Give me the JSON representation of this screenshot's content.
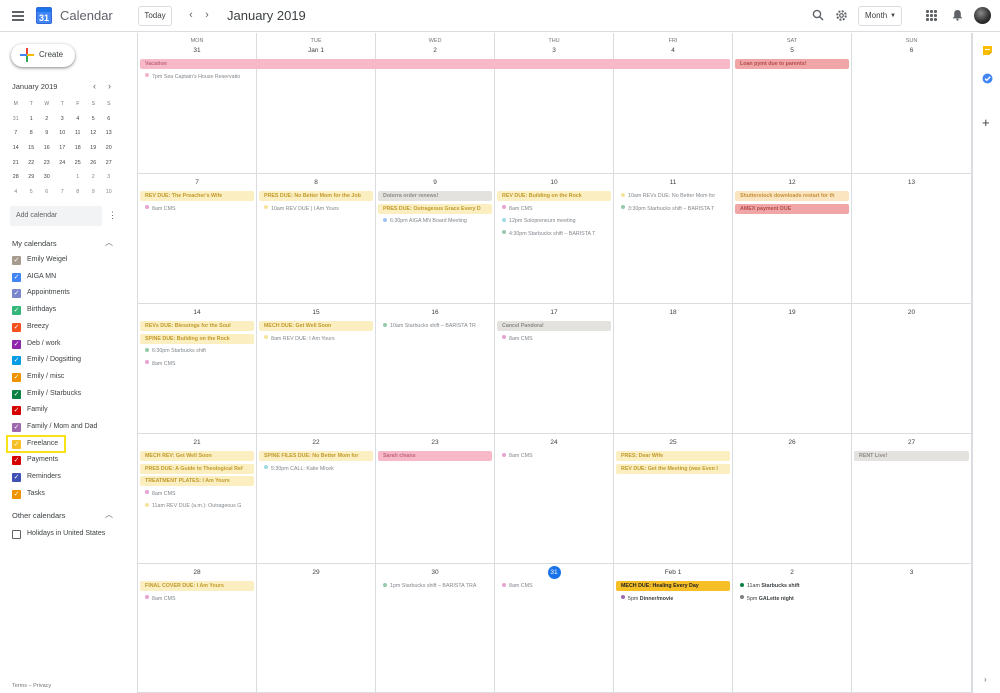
{
  "header": {
    "app_title": "Calendar",
    "logo_day": "31",
    "today_label": "Today",
    "prev_label": "‹",
    "next_label": "›",
    "month_title": "January 2019",
    "view_label": "Month",
    "icons": [
      "menu-icon",
      "search-icon",
      "gear-icon",
      "apps-icon",
      "notifications-icon"
    ]
  },
  "sidebar": {
    "create_label": "Create",
    "mini_calendar": {
      "title": "January 2019",
      "weekdays": [
        "M",
        "T",
        "W",
        "T",
        "F",
        "S",
        "S"
      ],
      "weeks": [
        [
          "31",
          "1",
          "2",
          "3",
          "4",
          "5",
          "6"
        ],
        [
          "7",
          "8",
          "9",
          "10",
          "11",
          "12",
          "13"
        ],
        [
          "14",
          "15",
          "16",
          "17",
          "18",
          "19",
          "20"
        ],
        [
          "21",
          "22",
          "23",
          "24",
          "25",
          "26",
          "27"
        ],
        [
          "28",
          "29",
          "30",
          "31",
          "1",
          "2",
          "3"
        ],
        [
          "4",
          "5",
          "6",
          "7",
          "8",
          "9",
          "10"
        ]
      ],
      "selected_day": "1",
      "today_day": "31"
    },
    "add_calendar_placeholder": "Add calendar",
    "my_calendars_title": "My calendars",
    "my_calendars": [
      {
        "name": "Emily Weigel",
        "color": "#a79b8e"
      },
      {
        "name": "AIGA MN",
        "color": "#4285f4"
      },
      {
        "name": "Appointments",
        "color": "#7986cb"
      },
      {
        "name": "Birthdays",
        "color": "#33b679"
      },
      {
        "name": "Breezy",
        "color": "#f4511e"
      },
      {
        "name": "Deb / work",
        "color": "#8e24aa"
      },
      {
        "name": "Emily / Dogsitting",
        "color": "#039be5"
      },
      {
        "name": "Emily / misc",
        "color": "#f09300"
      },
      {
        "name": "Emily / Starbucks",
        "color": "#0b8043"
      },
      {
        "name": "Family",
        "color": "#d50000"
      },
      {
        "name": "Family / Mom and Dad",
        "color": "#9e69af"
      },
      {
        "name": "Freelance",
        "color": "#f6bf26"
      },
      {
        "name": "Payments",
        "color": "#d50000"
      },
      {
        "name": "Reminders",
        "color": "#3f51b5"
      },
      {
        "name": "Tasks",
        "color": "#f09300"
      }
    ],
    "highlighted_calendar": "Freelance",
    "other_calendars_title": "Other calendars",
    "other_calendars": [
      {
        "name": "Holidays in United States",
        "checked": false
      }
    ],
    "footer": {
      "terms": "Terms",
      "separator": "–",
      "privacy": "Privacy"
    }
  },
  "grid": {
    "weekday_labels": [
      "MON",
      "TUE",
      "WED",
      "THU",
      "FRI",
      "SAT",
      "SUN"
    ],
    "weeks": [
      {
        "days": [
          "31",
          "Jan 1",
          "2",
          "3",
          "4",
          "5",
          "6"
        ],
        "events": [
          {
            "col": 0,
            "span": 5,
            "row": 0,
            "text": "Vacation",
            "kind": "bar",
            "bg": "#f7b8c8",
            "fg": "#c1667d"
          },
          {
            "col": 5,
            "span": 1,
            "row": 0,
            "text": "Loan pymt due to parents!",
            "kind": "bar",
            "bg": "#f0a6a6",
            "fg": "#b34c4c"
          },
          {
            "col": 0,
            "span": 1,
            "row": 1,
            "time": "7pm",
            "text": "Sea Captain's House Reservatio",
            "kind": "timed",
            "dot": "#f2b6c6",
            "dim": true
          }
        ]
      },
      {
        "days": [
          "7",
          "8",
          "9",
          "10",
          "11",
          "12",
          "13"
        ],
        "events": [
          {
            "col": 0,
            "span": 1,
            "row": 0,
            "text": "REV DUE: The Preacher's Wife",
            "kind": "bar",
            "bg": "#fbeec0",
            "fg": "#c19a2a"
          },
          {
            "col": 0,
            "span": 1,
            "row": 1,
            "time": "8am",
            "text": "CMS",
            "kind": "timed",
            "dot": "#e6a2d3",
            "dim": true
          },
          {
            "col": 1,
            "span": 1,
            "row": 0,
            "text": "PRES DUE: No Better Mom for the Job",
            "kind": "bar",
            "bg": "#fbeec0",
            "fg": "#c19a2a"
          },
          {
            "col": 1,
            "span": 1,
            "row": 1,
            "time": "10am",
            "text": "REV DUE | I Am Yours",
            "kind": "timed",
            "dot": "#f6e49a",
            "dim": true
          },
          {
            "col": 2,
            "span": 1,
            "row": 0,
            "text": "Doterra order renews!",
            "kind": "bar",
            "bg": "#e4e2de",
            "fg": "#8d8a85"
          },
          {
            "col": 2,
            "span": 1,
            "row": 1,
            "text": "PRES DUE: Outrageous Grace Every D",
            "kind": "bar",
            "bg": "#fbeec0",
            "fg": "#c19a2a"
          },
          {
            "col": 2,
            "span": 1,
            "row": 2,
            "time": "6:30pm",
            "text": "AIGA MN Board Meeting",
            "kind": "timed",
            "dot": "#9ec2f6",
            "dim": true
          },
          {
            "col": 3,
            "span": 1,
            "row": 0,
            "text": "REV DUE: Building on the Rock",
            "kind": "bar",
            "bg": "#fbeec0",
            "fg": "#c19a2a"
          },
          {
            "col": 3,
            "span": 1,
            "row": 1,
            "time": "8am",
            "text": "CMS",
            "kind": "timed",
            "dot": "#e6a2d3",
            "dim": true
          },
          {
            "col": 3,
            "span": 1,
            "row": 2,
            "time": "12pm",
            "text": "Solopreneurs meeting",
            "kind": "timed",
            "dot": "#9fd9e4",
            "dim": true
          },
          {
            "col": 3,
            "span": 1,
            "row": 3,
            "time": "4:30pm",
            "text": "Starbucks shift – BARISTA T",
            "kind": "timed",
            "dot": "#98c9a9",
            "dim": true
          },
          {
            "col": 4,
            "span": 1,
            "row": 0,
            "time": "10am",
            "text": "REVs DUE: No Better Mom for",
            "kind": "timed",
            "dot": "#f6e49a",
            "dim": true
          },
          {
            "col": 4,
            "span": 1,
            "row": 1,
            "time": "3:30pm",
            "text": "Starbucks shift – BARISTA T",
            "kind": "timed",
            "dot": "#98c9a9",
            "dim": true
          },
          {
            "col": 5,
            "span": 1,
            "row": 0,
            "text": "Shutterstock downloads restart for th",
            "kind": "bar",
            "bg": "#fbe5c0",
            "fg": "#c69036"
          },
          {
            "col": 5,
            "span": 1,
            "row": 1,
            "text": "AMEX payment DUE",
            "kind": "bar",
            "bg": "#f0a6a6",
            "fg": "#b34c4c"
          }
        ]
      },
      {
        "days": [
          "14",
          "15",
          "16",
          "17",
          "18",
          "19",
          "20"
        ],
        "events": [
          {
            "col": 0,
            "span": 1,
            "row": 0,
            "text": "REVs DUE: Blessings for the Soul",
            "kind": "bar",
            "bg": "#fbeec0",
            "fg": "#c19a2a"
          },
          {
            "col": 0,
            "span": 1,
            "row": 1,
            "text": "SPINE DUE: Building on the Rock",
            "kind": "bar",
            "bg": "#fbeec0",
            "fg": "#c19a2a"
          },
          {
            "col": 0,
            "span": 1,
            "row": 2,
            "time": "6:30pm",
            "text": "Starbucks shift",
            "kind": "timed",
            "dot": "#98c9a9",
            "dim": true
          },
          {
            "col": 0,
            "span": 1,
            "row": 3,
            "time": "8am",
            "text": "CMS",
            "kind": "timed",
            "dot": "#e6a2d3",
            "dim": true
          },
          {
            "col": 1,
            "span": 1,
            "row": 0,
            "text": "MECH DUE: Get Well Soon",
            "kind": "bar",
            "bg": "#fbeec0",
            "fg": "#c19a2a"
          },
          {
            "col": 1,
            "span": 1,
            "row": 1,
            "time": "8am",
            "text": "REV DUE: I Am Yours",
            "kind": "timed",
            "dot": "#f6e49a",
            "dim": true
          },
          {
            "col": 2,
            "span": 1,
            "row": 0,
            "time": "10am",
            "text": "Starbucks shift – BARISTA TR",
            "kind": "timed",
            "dot": "#98c9a9",
            "dim": true
          },
          {
            "col": 3,
            "span": 1,
            "row": 0,
            "text": "Cancel Pandora!",
            "kind": "bar",
            "bg": "#e4e2de",
            "fg": "#8d8a85"
          },
          {
            "col": 3,
            "span": 1,
            "row": 1,
            "time": "8am",
            "text": "CMS",
            "kind": "timed",
            "dot": "#e6a2d3",
            "dim": true
          }
        ]
      },
      {
        "days": [
          "21",
          "22",
          "23",
          "24",
          "25",
          "26",
          "27"
        ],
        "events": [
          {
            "col": 0,
            "span": 1,
            "row": 0,
            "text": "MECH REV: Get Well Soon",
            "kind": "bar",
            "bg": "#fbeec0",
            "fg": "#c19a2a"
          },
          {
            "col": 0,
            "span": 1,
            "row": 1,
            "text": "PRES DUE: A Guide to Theological Ref",
            "kind": "bar",
            "bg": "#fbeec0",
            "fg": "#c19a2a"
          },
          {
            "col": 0,
            "span": 1,
            "row": 2,
            "text": "TREATMENT PLATES: I Am Yours",
            "kind": "bar",
            "bg": "#fbeec0",
            "fg": "#c19a2a"
          },
          {
            "col": 0,
            "span": 1,
            "row": 3,
            "time": "8am",
            "text": "CMS",
            "kind": "timed",
            "dot": "#e6a2d3",
            "dim": true
          },
          {
            "col": 0,
            "span": 1,
            "row": 4,
            "time": "11am",
            "text": "REV DUE (a.m.): Outrageous G",
            "kind": "timed",
            "dot": "#f6e49a",
            "dim": true
          },
          {
            "col": 1,
            "span": 1,
            "row": 0,
            "text": "SPINE FILES DUE: No Better Mom for",
            "kind": "bar",
            "bg": "#fbeec0",
            "fg": "#c19a2a"
          },
          {
            "col": 1,
            "span": 1,
            "row": 1,
            "time": "5:30pm",
            "text": "CALL: Katie Micek",
            "kind": "timed",
            "dot": "#9fd9e4",
            "dim": true
          },
          {
            "col": 2,
            "span": 1,
            "row": 0,
            "text": "Sarah cleans",
            "kind": "bar",
            "bg": "#f7b8c8",
            "fg": "#c1667d"
          },
          {
            "col": 3,
            "span": 1,
            "row": 0,
            "time": "8am",
            "text": "CMS",
            "kind": "timed",
            "dot": "#e6a2d3",
            "dim": true
          },
          {
            "col": 4,
            "span": 1,
            "row": 0,
            "text": "PRES: Dear Wife",
            "kind": "bar",
            "bg": "#fbeec0",
            "fg": "#c19a2a"
          },
          {
            "col": 4,
            "span": 1,
            "row": 1,
            "text": "REV DUE: Get the Meeting (was Even I",
            "kind": "bar",
            "bg": "#fbeec0",
            "fg": "#c19a2a"
          },
          {
            "col": 6,
            "span": 1,
            "row": 0,
            "text": "RENT Live!",
            "kind": "bar",
            "bg": "#e4e2de",
            "fg": "#8d8a85"
          }
        ]
      },
      {
        "days": [
          "28",
          "29",
          "30",
          "31",
          "Feb 1",
          "2",
          "3"
        ],
        "events": [
          {
            "col": 0,
            "span": 1,
            "row": 0,
            "text": "FINAL COVER DUE: I Am Yours",
            "kind": "bar",
            "bg": "#fbeec0",
            "fg": "#c19a2a"
          },
          {
            "col": 0,
            "span": 1,
            "row": 1,
            "time": "8am",
            "text": "CMS",
            "kind": "timed",
            "dot": "#e6a2d3",
            "dim": true
          },
          {
            "col": 2,
            "span": 1,
            "row": 0,
            "time": "1pm",
            "text": "Starbucks shift – BARISTA TRA",
            "kind": "timed",
            "dot": "#98c9a9",
            "dim": true
          },
          {
            "col": 3,
            "span": 1,
            "row": 0,
            "time": "8am",
            "text": "CMS",
            "kind": "timed",
            "dot": "#e6a2d3",
            "dim": true
          },
          {
            "col": 4,
            "span": 1,
            "row": 0,
            "text": "MECH DUE: Healing Every Day",
            "kind": "bar",
            "bg": "#f6bf26",
            "fg": "#202124"
          },
          {
            "col": 4,
            "span": 1,
            "row": 1,
            "time": "5pm",
            "text": "Dinner/movie",
            "kind": "timed",
            "dot": "#9e69af",
            "dim": false
          },
          {
            "col": 5,
            "span": 1,
            "row": 0,
            "time": "11am",
            "text": "Starbucks shift",
            "kind": "timed",
            "dot": "#0b8043",
            "dim": false
          },
          {
            "col": 5,
            "span": 1,
            "row": 1,
            "time": "5pm",
            "text": "GALette night",
            "kind": "timed",
            "dot": "#7f7f7f",
            "dim": false
          }
        ]
      }
    ],
    "today_label": "31"
  }
}
